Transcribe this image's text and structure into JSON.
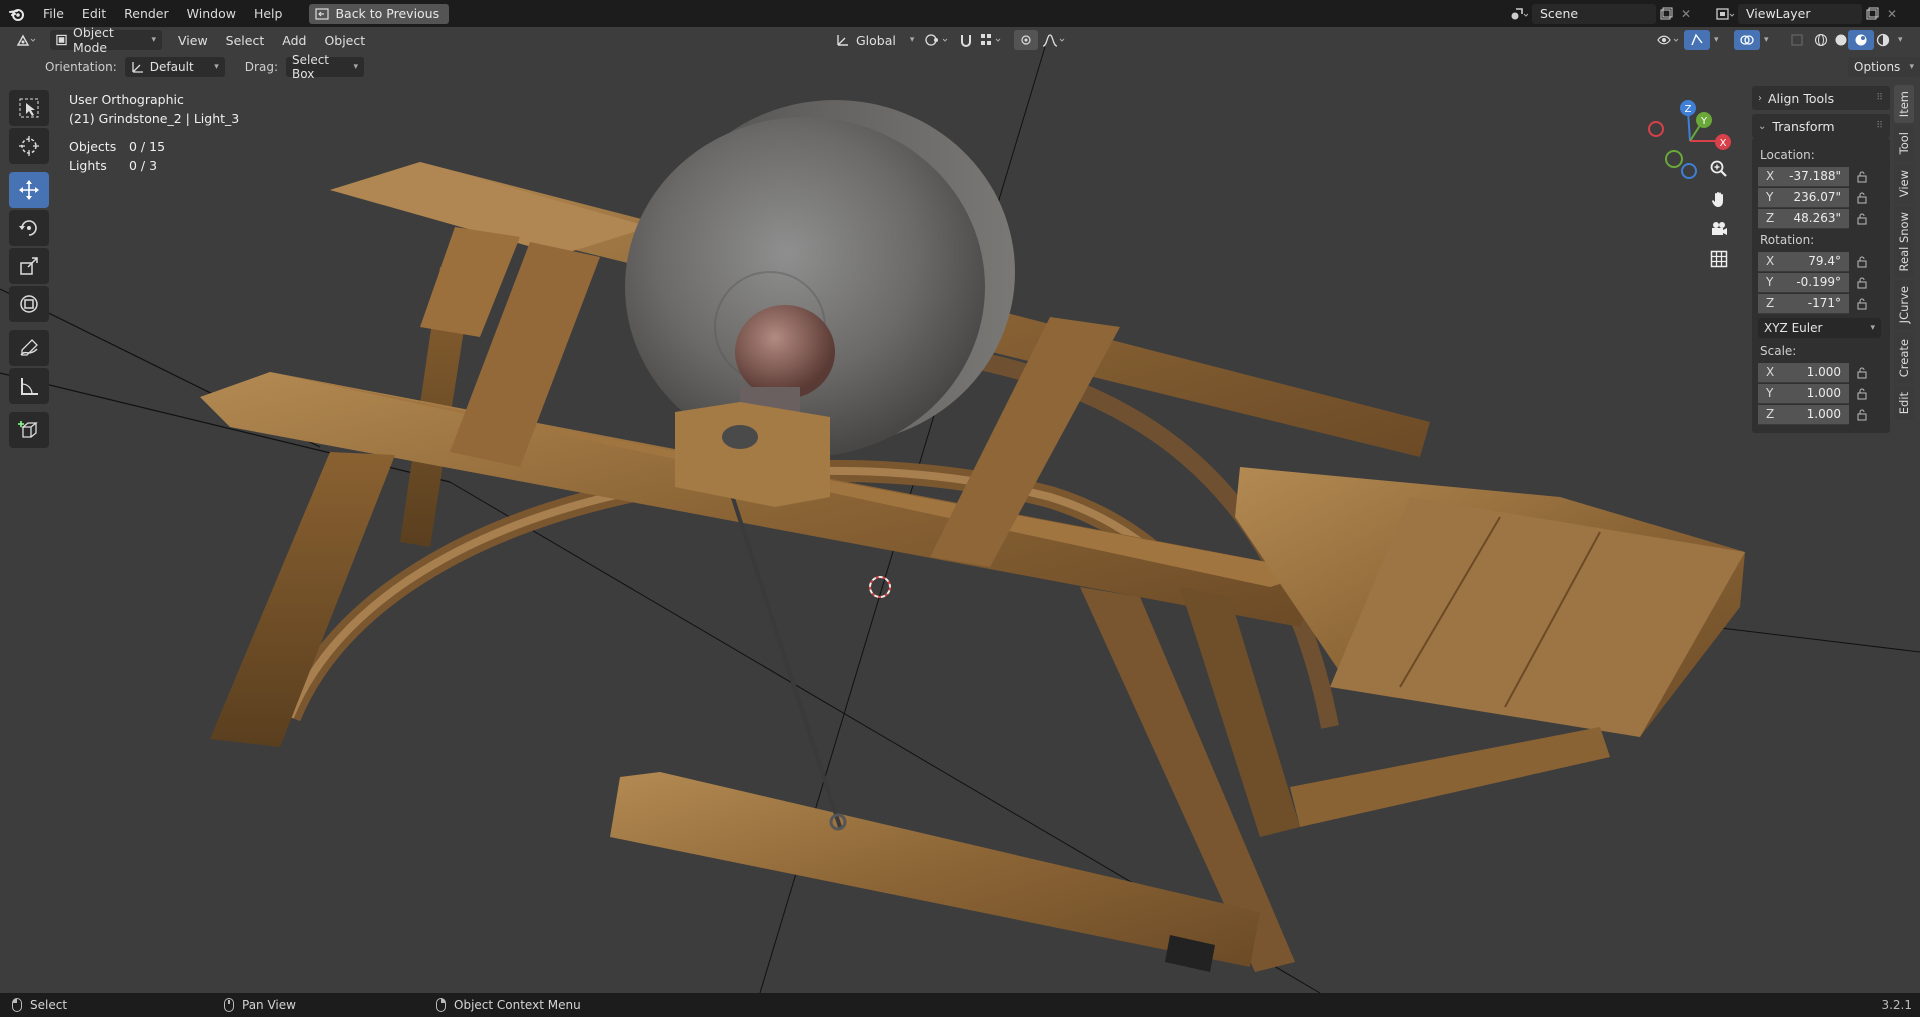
{
  "topbar": {
    "menus": [
      "File",
      "Edit",
      "Render",
      "Window",
      "Help"
    ],
    "back_label": "Back to Previous",
    "scene_name": "Scene",
    "view_layer": "ViewLayer"
  },
  "viewport_header": {
    "mode": "Object Mode",
    "menus": [
      "View",
      "Select",
      "Add",
      "Object"
    ],
    "transform_orientation": "Global"
  },
  "tool_settings": {
    "orientation_label": "Orientation:",
    "orientation_value": "Default",
    "drag_label": "Drag:",
    "drag_value": "Select Box",
    "options_label": "Options"
  },
  "overlay": {
    "view_name": "User Orthographic",
    "object_info": "(21) Grindstone_2 | Light_3",
    "stats": [
      {
        "key": "Objects",
        "value": "0 / 15"
      },
      {
        "key": "Lights",
        "value": "0 / 3"
      }
    ]
  },
  "gizmo": {
    "x": "X",
    "y": "Y",
    "z": "Z"
  },
  "npanel": {
    "align_tools": "Align Tools",
    "transform": "Transform",
    "location_label": "Location:",
    "location": [
      {
        "axis": "X",
        "value": "-37.188\""
      },
      {
        "axis": "Y",
        "value": "236.07\""
      },
      {
        "axis": "Z",
        "value": "48.263\""
      }
    ],
    "rotation_label": "Rotation:",
    "rotation": [
      {
        "axis": "X",
        "value": "79.4°"
      },
      {
        "axis": "Y",
        "value": "-0.199°"
      },
      {
        "axis": "Z",
        "value": "-171°"
      }
    ],
    "rotation_mode": "XYZ Euler",
    "scale_label": "Scale:",
    "scale": [
      {
        "axis": "X",
        "value": "1.000"
      },
      {
        "axis": "Y",
        "value": "1.000"
      },
      {
        "axis": "Z",
        "value": "1.000"
      }
    ]
  },
  "side_tabs": [
    "Item",
    "Tool",
    "View",
    "Real Snow",
    "JCurve",
    "Create",
    "Edit"
  ],
  "statusbar": {
    "select": "Select",
    "pan": "Pan View",
    "context": "Object Context Menu",
    "version": "3.2.1"
  }
}
